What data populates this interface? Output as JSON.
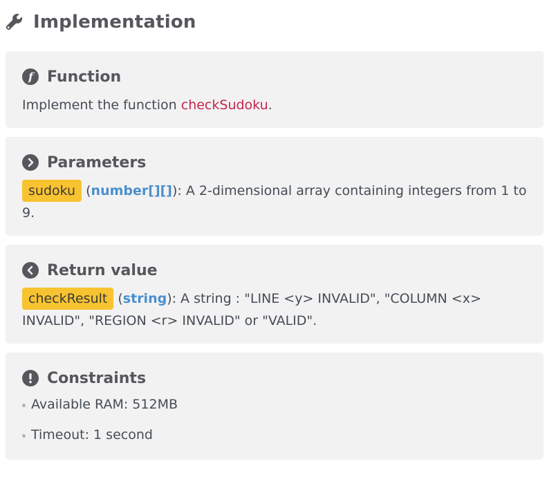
{
  "page": {
    "title": "Implementation"
  },
  "function": {
    "title": "Function",
    "text_prefix": "Implement the function ",
    "function_name": "checkSudoku",
    "text_suffix": "."
  },
  "parameters": {
    "title": "Parameters",
    "param_name": "sudoku",
    "open_paren": " (",
    "param_type": "number[][]",
    "description": "): A 2-dimensional array containing integers from 1 to 9."
  },
  "return_value": {
    "title": "Return value",
    "name": "checkResult",
    "open_paren": " (",
    "type": "string",
    "description": "): A string : \"LINE <y> INVALID\", \"COLUMN <x> INVALID\", \"REGION <r> INVALID\" or \"VALID\"."
  },
  "constraints": {
    "title": "Constraints",
    "items": [
      "Available RAM: 512MB",
      "Timeout: 1 second"
    ]
  },
  "colors": {
    "card_background": "#f2f2f2",
    "chip_background": "#f8c330",
    "type_blue": "#4a8fce",
    "function_red": "#c7254e",
    "heading_gray": "#56575c"
  },
  "icons": {
    "title": "wrench-icon",
    "function": "function-icon",
    "parameters": "chevron-right-circle-icon",
    "return_value": "chevron-left-circle-icon",
    "constraints": "exclamation-circle-icon"
  }
}
